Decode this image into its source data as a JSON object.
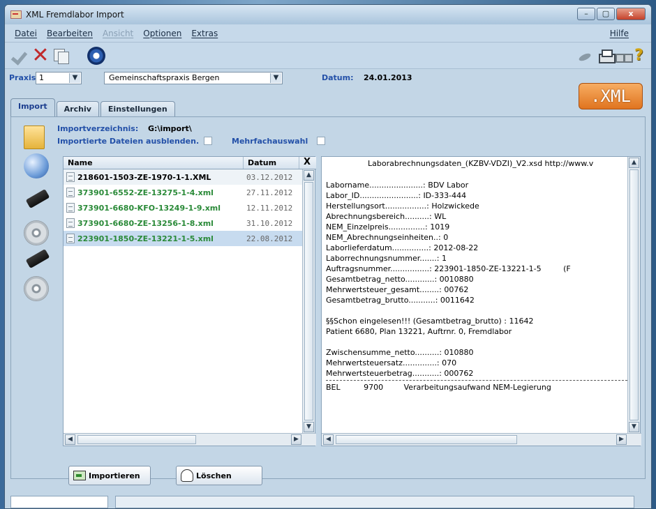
{
  "window": {
    "title": "XML Fremdlabor Import",
    "buttons": {
      "minimize": "–",
      "maximize": "▢",
      "close": "x"
    }
  },
  "menu": {
    "items": [
      "Datei",
      "Bearbeiten",
      "Ansicht",
      "Optionen",
      "Extras"
    ],
    "help": "Hilfe",
    "disabled": [
      "Ansicht"
    ]
  },
  "toolbar": {
    "icons": [
      "check-icon",
      "x-icon",
      "copy-icon",
      "refresh-icon",
      "pin-icon",
      "printer-icon",
      "glasses-icon",
      "help-icon"
    ],
    "x_glyph": "✕",
    "help_glyph": "?"
  },
  "praxis": {
    "label": "Praxis",
    "number": "1",
    "name": "Gemeinschaftspraxis Bergen",
    "dropdown_arrow": "▼"
  },
  "datum": {
    "label": "Datum:",
    "value": "24.01.2013"
  },
  "logo": {
    "text": ".XML"
  },
  "tabs": [
    {
      "label": "Import",
      "active": true
    },
    {
      "label": "Archiv",
      "active": false
    },
    {
      "label": "Einstellungen",
      "active": false
    }
  ],
  "import": {
    "dir_label": "Importverzeichnis:",
    "dir_value": "G:\\import\\",
    "hide_label": "Importierte Dateien ausblenden.",
    "multi_label": "Mehrfachauswahl"
  },
  "file_table": {
    "col_name": "Name",
    "col_date": "Datum",
    "col_x": "X",
    "rows": [
      {
        "name": "218601-1503-ZE-1970-1-1.XML",
        "date": "03.12.2012",
        "color": "#000000"
      },
      {
        "name": "373901-6552-ZE-13275-1-4.xml",
        "date": "27.11.2012",
        "color": "#2a8a38"
      },
      {
        "name": "373901-6680-KFO-13249-1-9.xml",
        "date": "12.11.2012",
        "color": "#2a8a38"
      },
      {
        "name": "373901-6680-ZE-13256-1-8.xml",
        "date": "31.10.2012",
        "color": "#2a8a38"
      },
      {
        "name": "223901-1850-ZE-13221-1-5.xml",
        "date": "22.08.2012",
        "color": "#2a8a38"
      }
    ]
  },
  "scroll": {
    "up": "▲",
    "down": "▼",
    "left": "◀",
    "right": "▶",
    "grip": "III"
  },
  "detail": {
    "header": "Laborabrechnungsdaten_(KZBV-VDZI)_V2.xsd   http://www.v",
    "fields": [
      "Laborname......................: BDV Labor",
      "Labor_ID........................: ID-333-444",
      "Herstellungsort.................: Holzwickede",
      "Abrechnungsbereich..........: WL",
      "NEM_Einzelpreis...............: 1019",
      "NEM_Abrechnungseinheiten..: 0",
      "Laborlieferdatum...............: 2012-08-22",
      "Laborrechnungsnummer.......: 1",
      "Auftragsnummer................: 223901-1850-ZE-13221-1-5",
      "Gesamtbetrag_netto............: 0010880",
      "Mehrwertsteuer_gesamt........: 00762",
      "Gesamtbetrag_brutto...........: 0011642"
    ],
    "auftrag_extra": "(F",
    "note1": "§§Schon eingelesen!!! (Gesamtbetrag_brutto) : 11642",
    "note2": "Patient 6680, Plan 13221, Auftrnr. 0, Fremdlabor",
    "sums": [
      "Zwischensumme_netto..........: 010880",
      "Mehrwertsteuersatz..............: 070",
      "Mehrwertsteuerbetrag...........: 000762"
    ],
    "bel": {
      "code": "BEL",
      "num": "9700",
      "desc": "Verarbeitungsaufwand NEM-Legierung"
    }
  },
  "buttons": {
    "import": "Importieren",
    "delete": "Löschen"
  }
}
